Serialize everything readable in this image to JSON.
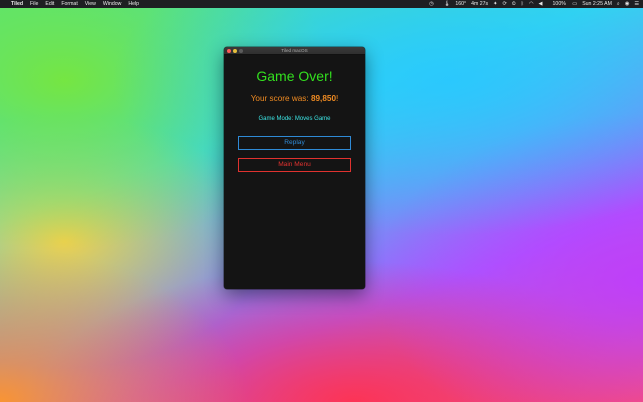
{
  "menubar": {
    "apple_icon": "",
    "app_name": "Tiled",
    "items": [
      "File",
      "Edit",
      "Format",
      "View",
      "Window",
      "Help"
    ],
    "status": {
      "temperature": "160°",
      "timer": "4m 27s",
      "battery": "100%",
      "clock": "Sun 2:25 AM"
    }
  },
  "window": {
    "title": "Tiled macOS",
    "heading": "Game Over!",
    "score_prefix": "Your score was: ",
    "score_value": "89,850",
    "score_suffix": "!",
    "game_mode": "Game Mode: Moves Game",
    "replay_label": "Replay",
    "main_menu_label": "Main Menu"
  },
  "colors": {
    "heading": "#33e01f",
    "score": "#ee8a22",
    "mode": "#3ce6e6",
    "replay": "#2f8ad6",
    "main_menu": "#e0322f",
    "window_bg": "#141414"
  }
}
